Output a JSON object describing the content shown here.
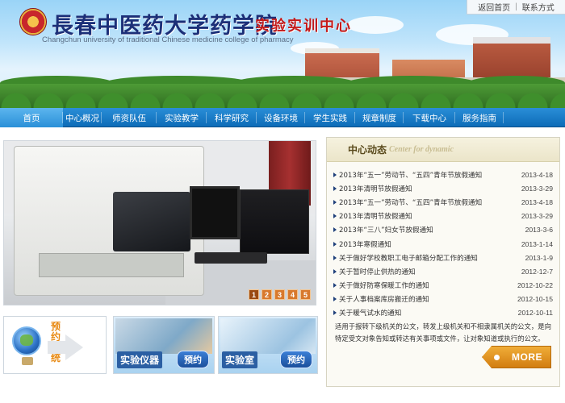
{
  "header": {
    "top_links": [
      "返回首页",
      "联系方式"
    ],
    "school_name": "長春中医药大学药学院",
    "center_name": "实验实训中心",
    "english_name": "Changchun university of traditional Chinese medicine college of pharmacy"
  },
  "nav": {
    "items": [
      "首页",
      "中心概况",
      "师资队伍",
      "实验教学",
      "科学研究",
      "设备环境",
      "学生实践",
      "规章制度",
      "下载中心",
      "服务指南"
    ],
    "active_index": 0
  },
  "carousel": {
    "pages": [
      "1",
      "2",
      "3",
      "4",
      "5"
    ],
    "current": "1"
  },
  "news": {
    "title": "中心动态",
    "subtitle": "Center for dynamic",
    "items": [
      {
        "title": "2013年“五一”劳动节、“五四”青年节放假通知",
        "date": "2013-4-18"
      },
      {
        "title": "2013年清明节放假通知",
        "date": "2013-3-29"
      },
      {
        "title": "2013年“五一”劳动节、“五四”青年节放假通知",
        "date": "2013-4-18"
      },
      {
        "title": "2013年清明节放假通知",
        "date": "2013-3-29"
      },
      {
        "title": "2013年“三八”妇女节放假通知",
        "date": "2013-3-6"
      },
      {
        "title": "2013年寒假通知",
        "date": "2013-1-14"
      },
      {
        "title": "关于做好学校教职工电子邮箱分配工作的通知",
        "date": "2013-1-9"
      },
      {
        "title": "关于暂时停止供热的通知",
        "date": "2012-12-7"
      },
      {
        "title": "关于做好防寒保暖工作的通知",
        "date": "2012-10-22"
      },
      {
        "title": "关于人事档案库房搬迁的通知",
        "date": "2012-10-15"
      },
      {
        "title": "关于暖气试水的通知",
        "date": "2012-10-11"
      }
    ],
    "footer_text": "适用于报转下级机关的公文，转发上级机关和不相隶属机关的公文，是向特定受文对象告知或转达有关事项或文件，让对象知道或执行的公文。",
    "more_label": "MORE"
  },
  "booking": {
    "system_label": "预约系统",
    "cards": [
      {
        "title": "实验仪器",
        "button": "预约"
      },
      {
        "title": "实验室",
        "button": "预约"
      }
    ]
  },
  "colors": {
    "nav_bg": "#0d6cb8",
    "nav_active": "#5cb5ee",
    "title_blue": "#1c2f78",
    "title_red": "#c41a1a",
    "more_orange": "#d27d10",
    "pager_orange": "#d8792d"
  }
}
